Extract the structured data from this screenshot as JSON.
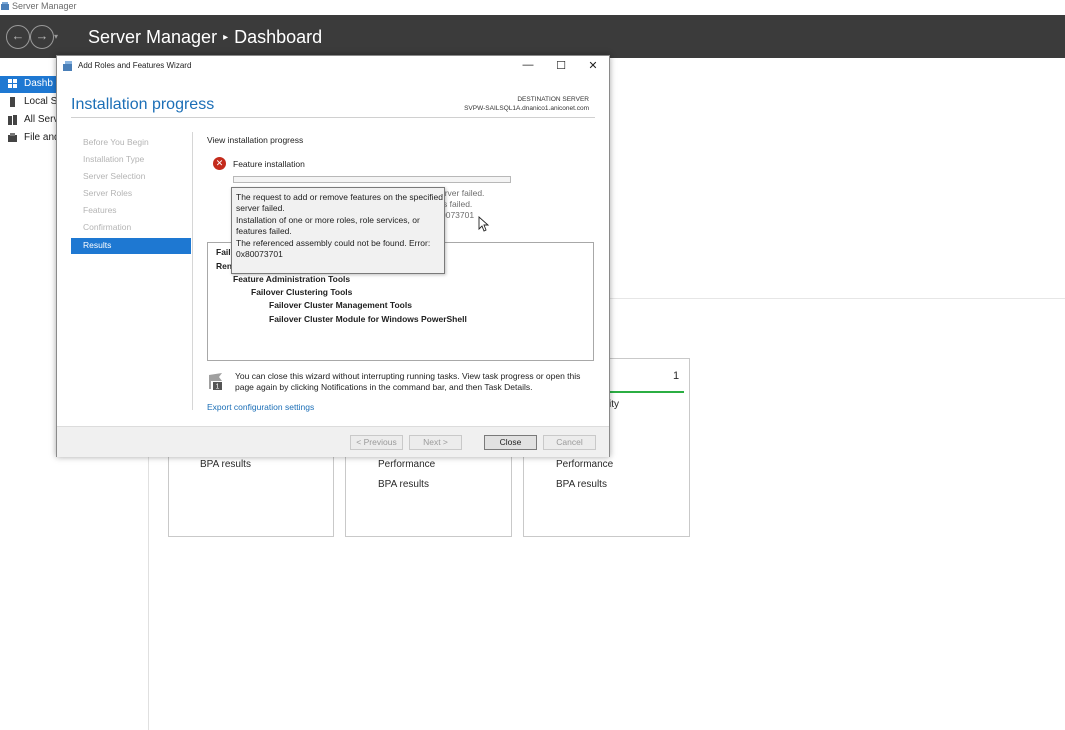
{
  "app": {
    "window_title": "Server Manager",
    "header_title": "Server Manager",
    "header_separator": "▸",
    "header_page": "Dashboard"
  },
  "nav": {
    "items": [
      {
        "label": "Dashb",
        "icon": "dashboard-icon",
        "active": true
      },
      {
        "label": "Local Se",
        "icon": "local-server-icon",
        "active": false
      },
      {
        "label": "All Serv",
        "icon": "all-servers-icon",
        "active": false
      },
      {
        "label": "File and",
        "icon": "file-storage-icon",
        "active": false
      }
    ]
  },
  "tiles": {
    "tile1": {
      "line1": "BPA results"
    },
    "tile2": {
      "line1": "Performance",
      "line2": "BPA results"
    },
    "tile3": {
      "count": "1",
      "partial": "ity",
      "line1": "Performance",
      "line2": "BPA results"
    },
    "accent_color": "#2bae43"
  },
  "wizard": {
    "title": "Add Roles and Features Wizard",
    "heading": "Installation progress",
    "destination_label": "DESTINATION SERVER",
    "destination_name": "SVPW-SAILSQL1A.dnanico1.aniconet.com",
    "steps": [
      {
        "label": "Before You Begin",
        "active": false
      },
      {
        "label": "Installation Type",
        "active": false
      },
      {
        "label": "Server Selection",
        "active": false
      },
      {
        "label": "Server Roles",
        "active": false
      },
      {
        "label": "Features",
        "active": false
      },
      {
        "label": "Confirmation",
        "active": false
      },
      {
        "label": "Results",
        "active": true
      }
    ],
    "view_progress": "View installation progress",
    "feature_installation": "Feature installation",
    "progress": 0,
    "ghost_lines": [
      "erver failed.",
      "s failed.",
      "0073701"
    ],
    "results": {
      "line1": "Faile",
      "line2": "Ren",
      "items": [
        "Feature Administration Tools",
        "Failover Clustering Tools",
        "Failover Cluster Management Tools",
        "Failover Cluster Module for Windows PowerShell"
      ]
    },
    "tooltip": [
      "The request to add or remove features on the specified",
      "server failed.",
      "Installation of one or more roles, role services, or",
      "features failed.",
      "The referenced assembly could not be found. Error:",
      "0x80073701"
    ],
    "note_line1": "You can close this wizard without interrupting running tasks. View task progress or open this",
    "note_line2": "page again by clicking Notifications in the command bar, and then Task Details.",
    "note_badge": "1",
    "export_link": "Export configuration settings",
    "buttons": {
      "previous": "< Previous",
      "next": "Next >",
      "close": "Close",
      "cancel": "Cancel"
    },
    "window_controls": {
      "minimize": "—",
      "maximize": "☐",
      "close": "✕"
    }
  },
  "colors": {
    "header_bg": "#3b3b3b",
    "accent_blue": "#1e78d2",
    "heading_blue": "#1c6fb7",
    "error_red": "#c42b1c"
  }
}
